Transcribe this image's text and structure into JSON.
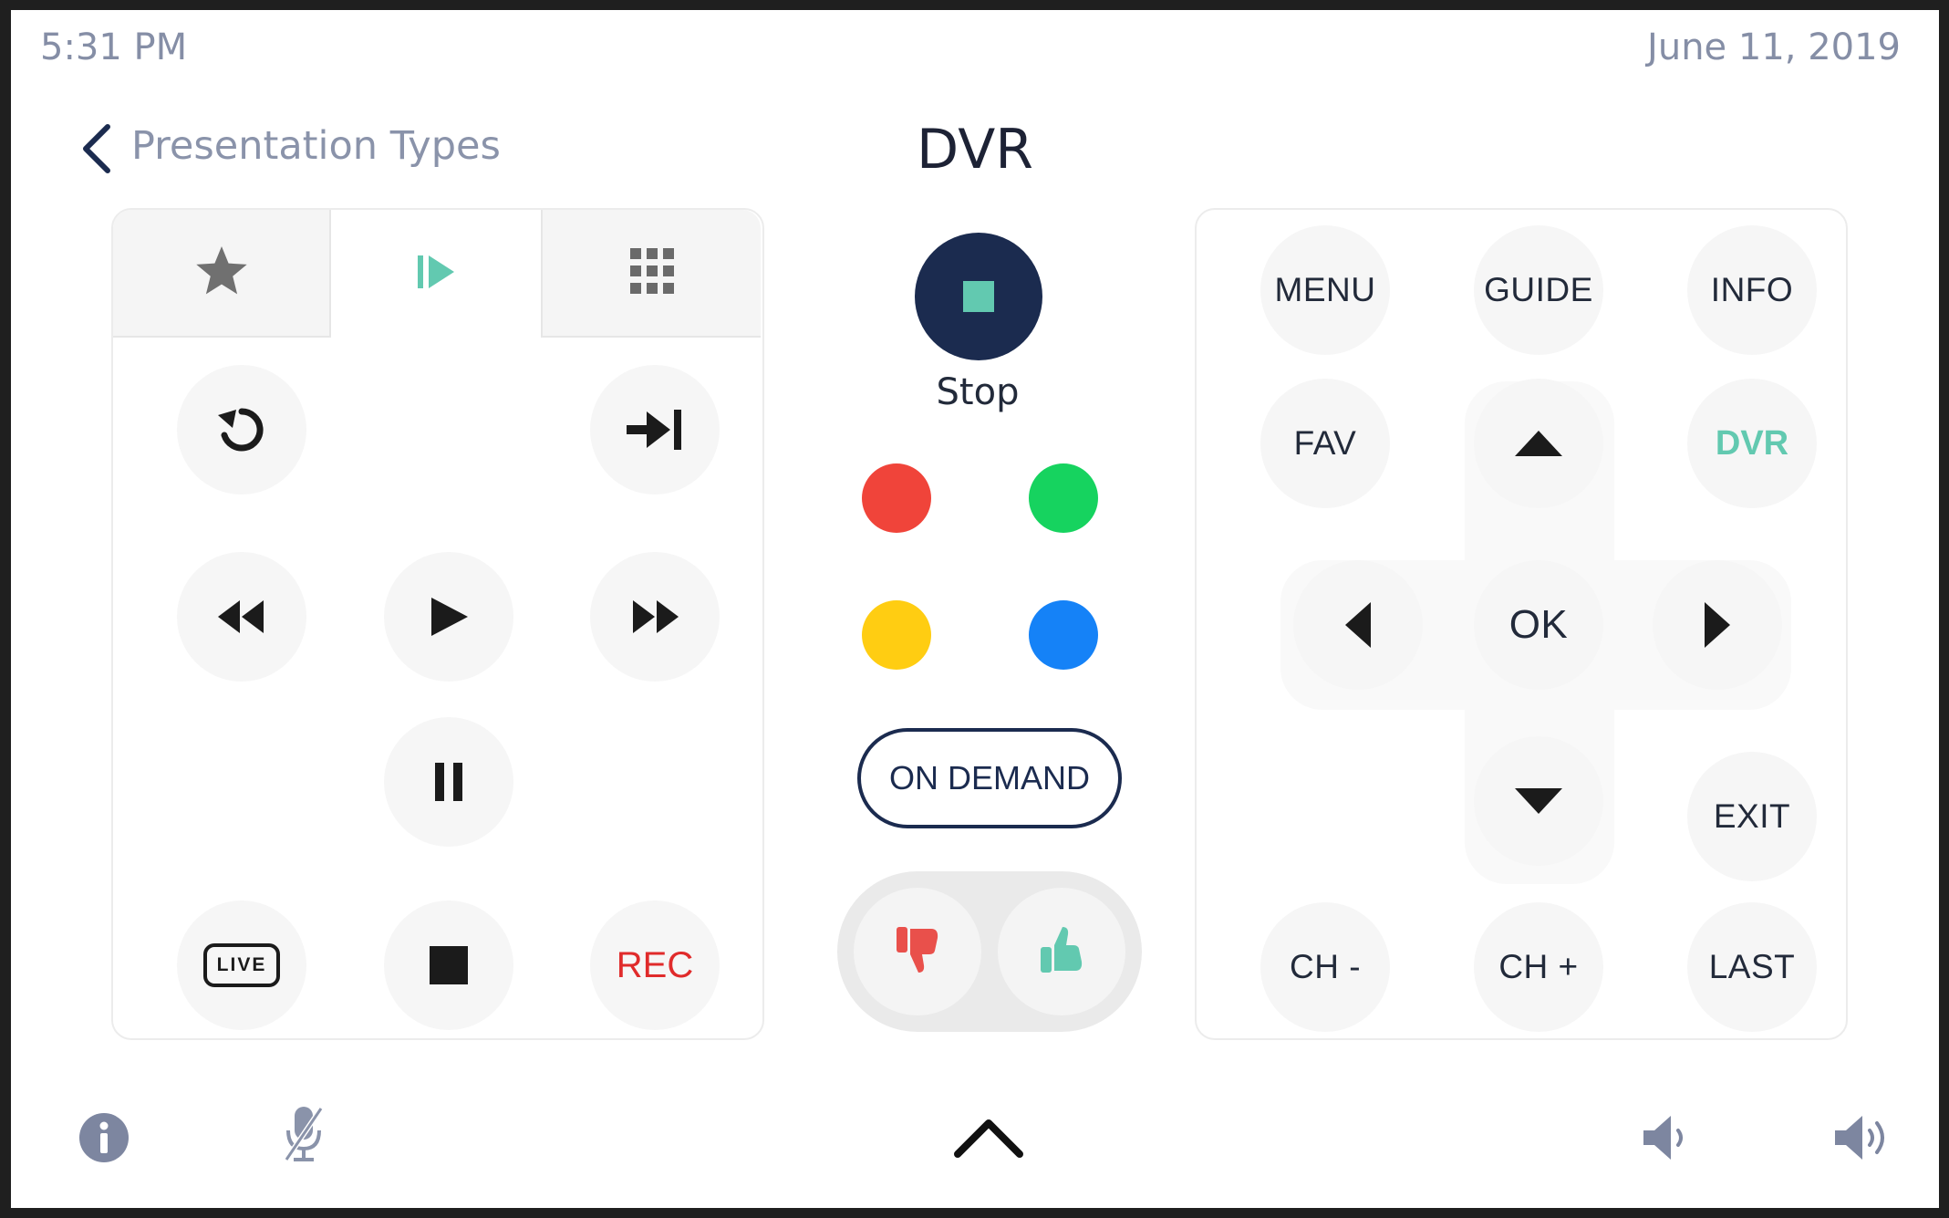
{
  "status_bar": {
    "time": "5:31 PM",
    "date": "June 11, 2019"
  },
  "header": {
    "back_label": "Presentation Types",
    "title": "DVR"
  },
  "left_panel": {
    "tabs": [
      {
        "icon": "star-icon",
        "active": false
      },
      {
        "icon": "play-skip-icon",
        "active": true
      },
      {
        "icon": "keypad-grid-icon",
        "active": false
      }
    ],
    "transport_buttons": [
      {
        "icon": "replay-icon"
      },
      {
        "icon": "skip-to-end-icon"
      },
      {
        "icon": "rewind-icon"
      },
      {
        "icon": "play-icon"
      },
      {
        "icon": "fast-forward-icon"
      },
      {
        "icon": "pause-icon"
      },
      {
        "icon": "live-icon"
      },
      {
        "icon": "stop-icon"
      }
    ],
    "live_label": "LIVE",
    "rec_label": "REC"
  },
  "center": {
    "stop_label": "Stop",
    "color_buttons": [
      {
        "name": "red",
        "color": "#f0443a"
      },
      {
        "name": "green",
        "color": "#16d35f"
      },
      {
        "name": "yellow",
        "color": "#ffcd12"
      },
      {
        "name": "blue",
        "color": "#1582f7"
      }
    ],
    "on_demand_label": "ON DEMAND",
    "thumbs": [
      {
        "icon": "thumbs-down-icon",
        "color": "#e9504b"
      },
      {
        "icon": "thumbs-up-icon",
        "color": "#62c9b0"
      }
    ]
  },
  "right_panel": {
    "menu_label": "MENU",
    "guide_label": "GUIDE",
    "info_label": "INFO",
    "fav_label": "FAV",
    "dvr_label": "DVR",
    "ok_label": "OK",
    "exit_label": "EXIT",
    "ch_down_label": "CH -",
    "ch_up_label": "CH +",
    "last_label": "LAST"
  },
  "bottom_bar": {
    "icons": [
      "info-icon",
      "mic-muted-icon",
      "chevron-up-icon",
      "volume-down-icon",
      "volume-up-icon"
    ]
  },
  "colors": {
    "accent": "#62c9b0",
    "navy": "#1b2b4f",
    "rec_red": "#e02b2b"
  }
}
